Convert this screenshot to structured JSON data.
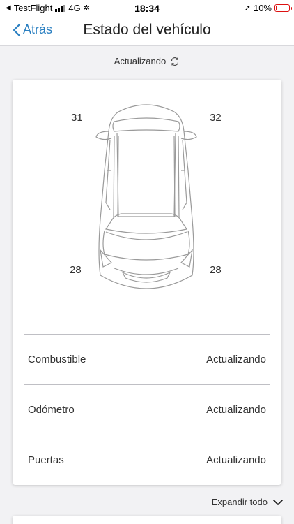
{
  "status_bar": {
    "back_app": "TestFlight",
    "network": "4G",
    "time": "18:34",
    "battery": "10%",
    "battery_level": 0.1
  },
  "nav": {
    "back_label": "Atrás",
    "title": "Estado del vehículo"
  },
  "update_status": "Actualizando",
  "tires": {
    "front_left": "31",
    "front_right": "32",
    "rear_left": "28",
    "rear_right": "28"
  },
  "rows": [
    {
      "label": "Combustible",
      "value": "Actualizando"
    },
    {
      "label": "Odómetro",
      "value": "Actualizando"
    },
    {
      "label": "Puertas",
      "value": "Actualizando"
    }
  ],
  "expand_label": "Expandir todo",
  "colors": {
    "accent": "#2a7fc1",
    "battery_low": "#d11111",
    "background": "#f2f2f4"
  }
}
